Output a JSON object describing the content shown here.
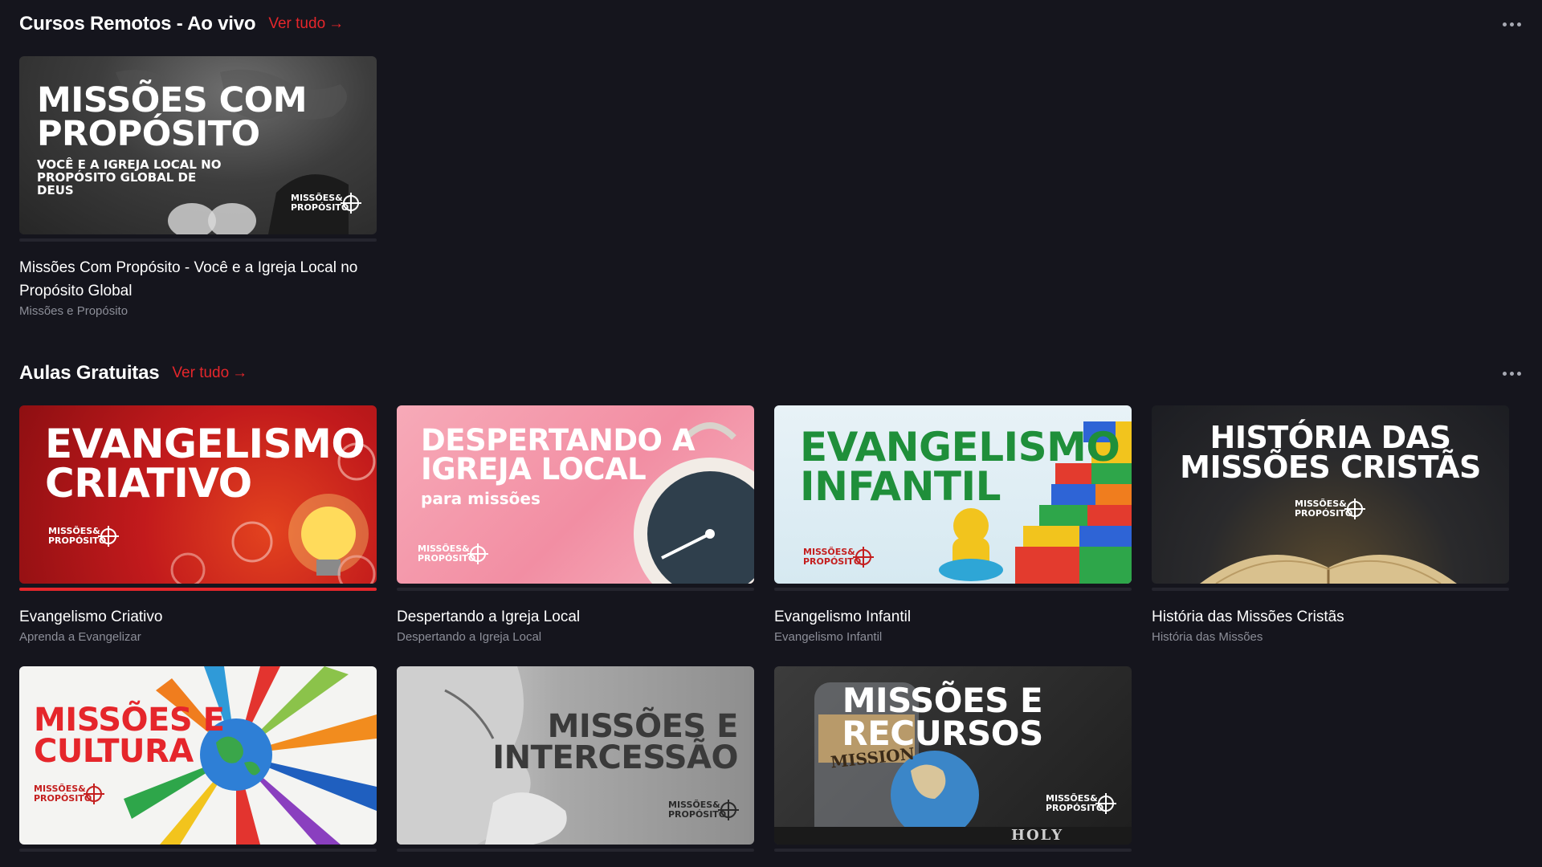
{
  "sections": [
    {
      "title": "Cursos Remotos - Ao vivo",
      "see_all": "Ver tudo",
      "cards": [
        {
          "thumb_heading": "MISSÕES COM PROPÓSITO",
          "thumb_sub": "VOCÊ E A IGREJA LOCAL NO PROPÓSITO GLOBAL DE DEUS",
          "logo_text": "MISSÕES& PROPÓSITO",
          "title": "Missões Com Propósito - Você e a Igreja Local no Propósito Global",
          "subtitle": "Missões e Propósito",
          "progress": 0
        }
      ]
    },
    {
      "title": "Aulas Gratuitas",
      "see_all": "Ver tudo",
      "cards": [
        {
          "thumb_heading": "EVANGELISMO CRIATIVO",
          "logo_text": "MISSÕES& PROPÓSITO",
          "title": "Evangelismo Criativo",
          "subtitle": "Aprenda a Evangelizar",
          "progress": 1.0
        },
        {
          "thumb_heading": "DESPERTANDO A IGREJA LOCAL",
          "thumb_sub": "para missões",
          "logo_text": "MISSÕES& PROPÓSITO",
          "title": "Despertando a Igreja Local",
          "subtitle": "Despertando a Igreja Local",
          "progress": 0
        },
        {
          "thumb_heading": "EVANGELISMO INFANTIL",
          "logo_text": "MISSÕES& PROPÓSITO",
          "title": "Evangelismo Infantil",
          "subtitle": "Evangelismo Infantil",
          "progress": 0
        },
        {
          "thumb_heading": "HISTÓRIA DAS MISSÕES CRISTÃS",
          "logo_text": "MISSÕES& PROPÓSITO",
          "title": "História das Missões Cristãs",
          "subtitle": "História das Missões",
          "progress": 0
        },
        {
          "thumb_heading": "MISSÕES E CULTURA",
          "logo_text": "MISSÕES& PROPÓSITO"
        },
        {
          "thumb_heading": "MISSÕES E INTERCESSÃO",
          "logo_text": "MISSÕES& PROPÓSITO"
        },
        {
          "thumb_heading": "MISSÕES E RECURSOS",
          "thumb_extra": "MISSION",
          "thumb_extra2": "HOLY",
          "logo_text": "MISSÕES& PROPÓSITO"
        }
      ]
    }
  ],
  "icons": {
    "arrow": "arrow-right-icon",
    "more": "more-horizontal-icon",
    "logo": "crosshair-globe-icon"
  },
  "colors": {
    "background": "#15151d",
    "accent": "#e5262b",
    "subtitle": "#8c8e98",
    "progress_track": "#25252e"
  }
}
